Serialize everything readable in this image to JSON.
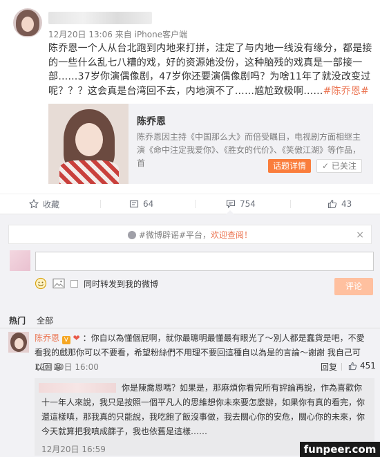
{
  "post": {
    "timestamp": "12月20日 13:06",
    "source_prefix": "来自",
    "source": "iPhone客户端",
    "text": "陈乔恩一个人从台北跑到内地来打拼，注定了与内地一线没有缘分，都是接的一些什么乱七八糟的戏，好的资源她没份，这种脑残的戏真是一部接一部……37岁你演偶像剧，47岁你还要演偶像剧吗？为啥11年了就没改变过呢？？？这会真是台湾回不去，内地演不了……尴尬致极啊……",
    "hashtag": "#陈乔恩#",
    "card": {
      "title": "陈乔恩",
      "description": "陈乔恩因主持《中国那么大》而倍受瞩目，电视剧方面相继主演《命中注定我爱你》、《胜女的代价》、《笑傲江湖》等作品，首",
      "detail_button": "话题详情",
      "follow_button": "已关注"
    },
    "actions": {
      "favorite_label": "收藏",
      "repost_count": "64",
      "comment_count": "754",
      "like_count": "43"
    }
  },
  "notice": {
    "text": "#微博辟谣#平台，",
    "link": "欢迎查阅！"
  },
  "composer": {
    "repost_label": "同时转发到我的微博",
    "submit_label": "评论"
  },
  "tabs": {
    "hot": "热门",
    "all": "全部"
  },
  "comment": {
    "author": "陈乔恩",
    "text": "：你自以為懂個屁啊，就你最聰明最懂最有眼光了～別人都是蠢貨是吧，不愛看我的戲那你可以不要看，希望粉絲們不用理不要回這種自以為是的言論～謝謝 我自己可以回",
    "time": "12月20日 16:00",
    "reply_label": "回复",
    "like_count": "451"
  },
  "reply": {
    "text": "你是陳喬恩嗎？如果是，那麻煩你看完所有評論再說，作為喜歡你十一年人來說，我只是按照一個平凡人的思維想你未來要怎麼辦，如果你有真的看完，你還這樣嗔，那我真的只能說，我吃飽了飯沒事做，我去關心你的安危，關心你的未來，你今天就算把我嗔成篩子，我也依舊是這樣……",
    "time": "12月20日 16:59"
  },
  "watermark": "funpeer.com",
  "colors": {
    "accent": "#eb7350",
    "button_orange": "#fa7d3c",
    "submit_disabled": "#ffc09f",
    "panel_bg": "#f2f2f5"
  },
  "icons": {
    "favorite": "star-icon",
    "repost": "repost-icon",
    "comment": "comment-icon",
    "like": "thumbs-up-icon",
    "emoji": "smiley-icon",
    "image": "image-icon",
    "notice": "info-icon",
    "close": "close-icon"
  }
}
